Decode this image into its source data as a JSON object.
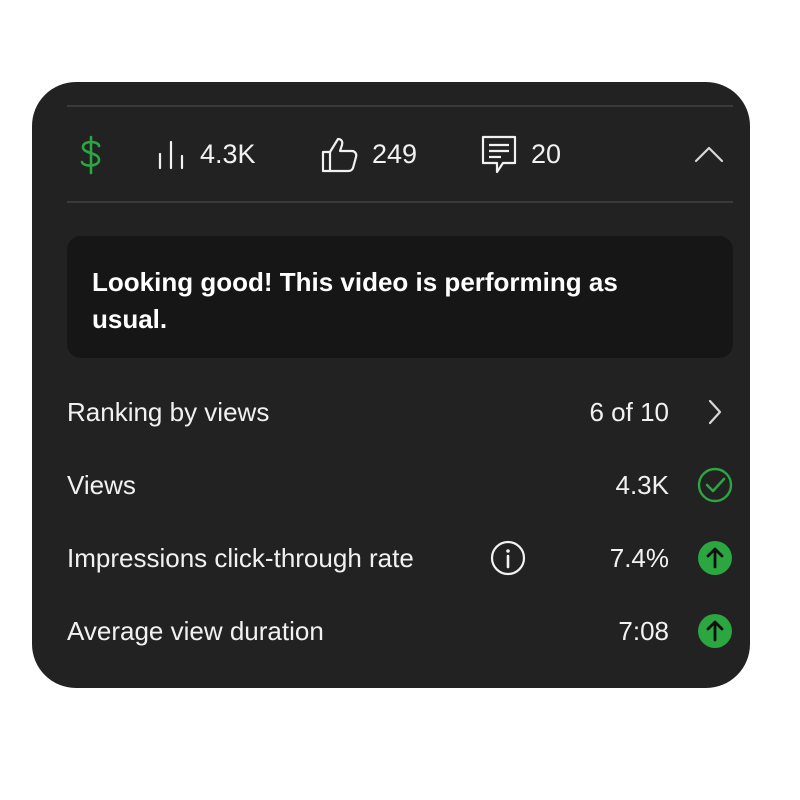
{
  "header_stats": {
    "icons": [
      "dollar-icon",
      "bar-chart-icon",
      "thumbs-up-icon",
      "comment-icon",
      "chevron-up-icon"
    ],
    "views": "4.3K",
    "likes": "249",
    "comments": "20"
  },
  "message": "Looking good! This video is performing as usual.",
  "metrics": [
    {
      "label": "Ranking by views",
      "value": "6 of 10",
      "status": "chevron-right-icon"
    },
    {
      "label": "Views",
      "value": "4.3K",
      "status": "check-circle-icon"
    },
    {
      "label": "Impressions click-through rate",
      "value": "7.4%",
      "status": "arrow-up-circle-icon",
      "info": "info-icon"
    },
    {
      "label": "Average view duration",
      "value": "7:08",
      "status": "arrow-up-circle-icon"
    }
  ],
  "colors": {
    "card_bg": "#222222",
    "message_bg": "#161616",
    "accent_green": "#2ba640",
    "text": "#f1f1f1"
  }
}
